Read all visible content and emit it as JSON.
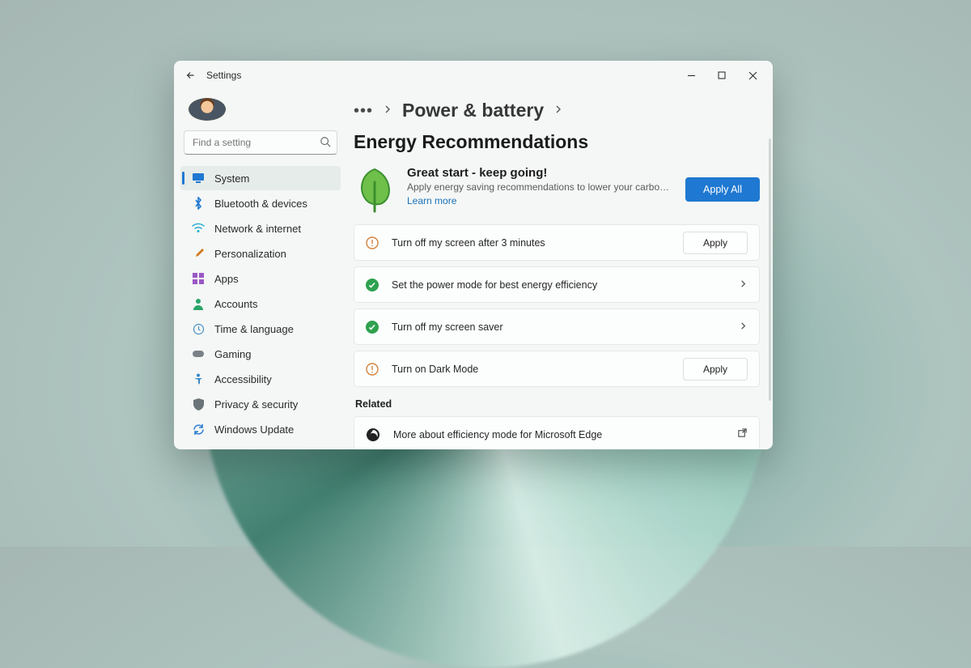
{
  "window": {
    "title": "Settings"
  },
  "search": {
    "placeholder": "Find a setting"
  },
  "sidebar": {
    "items": [
      {
        "label": "System",
        "icon": "display-icon",
        "color": "#1f78d1",
        "selected": true
      },
      {
        "label": "Bluetooth & devices",
        "icon": "bluetooth-icon",
        "color": "#1f78d1"
      },
      {
        "label": "Network & internet",
        "icon": "wifi-icon",
        "color": "#1fa9d1"
      },
      {
        "label": "Personalization",
        "icon": "paintbrush-icon",
        "color": "#d17a1f"
      },
      {
        "label": "Apps",
        "icon": "apps-icon",
        "color": "#9a58c6"
      },
      {
        "label": "Accounts",
        "icon": "person-icon",
        "color": "#2aa56a"
      },
      {
        "label": "Time & language",
        "icon": "globe-clock-icon",
        "color": "#4a90c6"
      },
      {
        "label": "Gaming",
        "icon": "gamepad-icon",
        "color": "#7a8288"
      },
      {
        "label": "Accessibility",
        "icon": "accessibility-icon",
        "color": "#3a87c6"
      },
      {
        "label": "Privacy & security",
        "icon": "shield-icon",
        "color": "#6a7478"
      },
      {
        "label": "Windows Update",
        "icon": "update-icon",
        "color": "#2a7bd1"
      }
    ]
  },
  "breadcrumb": {
    "parent": "Power & battery",
    "current": "Energy Recommendations"
  },
  "hero": {
    "title": "Great start - keep going!",
    "subtitle": "Apply energy saving recommendations to lower your carbon foo…",
    "learn_more": "Learn more",
    "apply_all": "Apply All"
  },
  "recommendations": [
    {
      "status": "pending",
      "label": "Turn off my screen after 3 minutes",
      "action": "apply",
      "action_label": "Apply"
    },
    {
      "status": "done",
      "label": "Set the power mode for best energy efficiency",
      "action": "expand"
    },
    {
      "status": "done",
      "label": "Turn off my screen saver",
      "action": "expand"
    },
    {
      "status": "pending",
      "label": "Turn on Dark Mode",
      "action": "apply",
      "action_label": "Apply"
    }
  ],
  "related": {
    "heading": "Related",
    "items": [
      {
        "label": "More about efficiency mode for Microsoft Edge",
        "icon": "edge-icon"
      }
    ]
  },
  "colors": {
    "accent": "#1f78d1",
    "success": "#2fa14f",
    "warning": "#d4823c"
  }
}
